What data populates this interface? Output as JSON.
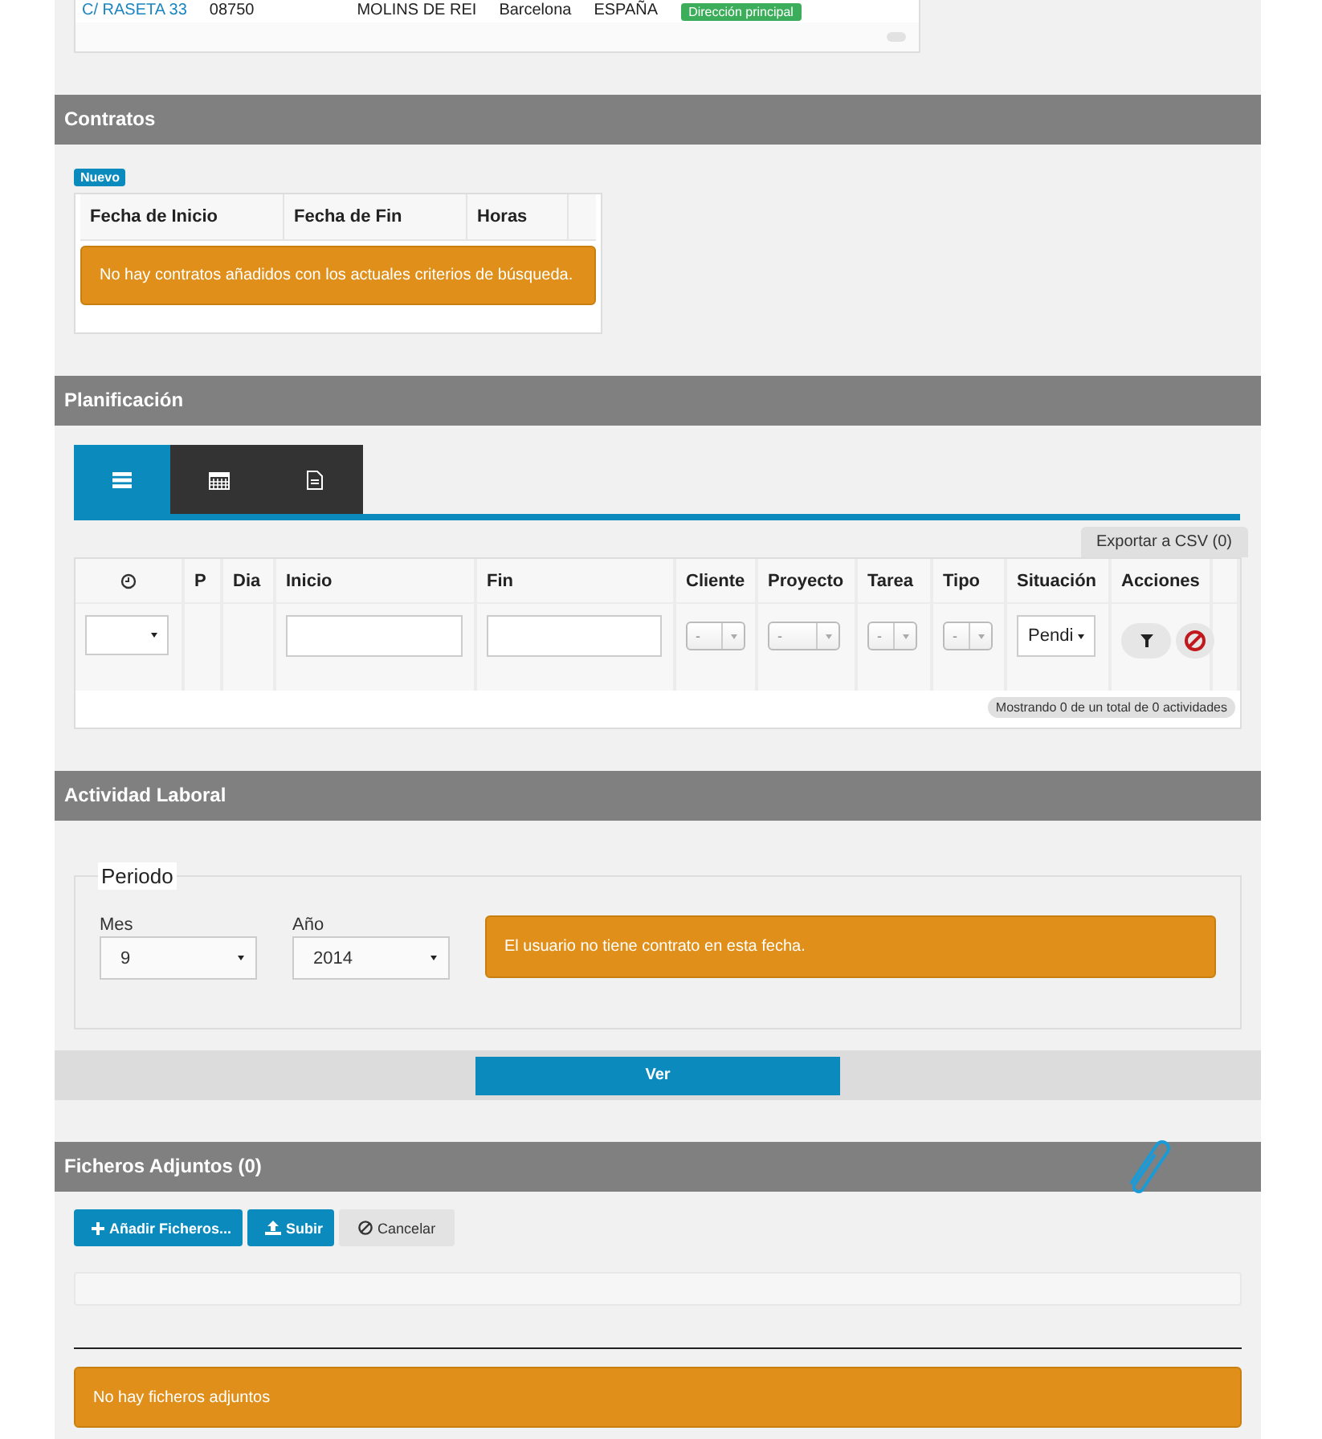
{
  "address": {
    "street": "C/ RASETA 33",
    "postal_code": "08750",
    "city": "MOLINS DE REI",
    "province": "Barcelona",
    "country": "ESPAÑA",
    "badge": "Dirección principal"
  },
  "contratos": {
    "title": "Contratos",
    "new_badge": "Nuevo",
    "columns": [
      "Fecha de Inicio",
      "Fecha de Fin",
      "Horas"
    ],
    "empty_message": "No hay contratos añadidos con los actuales criterios de búsqueda."
  },
  "planificacion": {
    "title": "Planificación",
    "tabs": [
      {
        "selected": true
      },
      {
        "selected": false
      },
      {
        "selected": false
      }
    ],
    "export_button": "Exportar a CSV (0)",
    "columns": [
      {
        "kind": "clock",
        "filter": {
          "kind": "select"
        }
      },
      {
        "kind": "text",
        "label": "P",
        "filter": {
          "kind": "none"
        }
      },
      {
        "kind": "text",
        "label": "Dia",
        "filter": {
          "kind": "none"
        }
      },
      {
        "kind": "text",
        "label": "Inicio",
        "filter": {
          "kind": "input"
        }
      },
      {
        "kind": "text",
        "label": "Fin",
        "filter": {
          "kind": "input"
        }
      },
      {
        "kind": "text",
        "label": "Cliente",
        "filter": {
          "kind": "combo",
          "value": "-"
        }
      },
      {
        "kind": "text",
        "label": "Proyecto",
        "filter": {
          "kind": "combo",
          "value": "-"
        }
      },
      {
        "kind": "text",
        "label": "Tarea",
        "filter": {
          "kind": "combo",
          "value": "-"
        }
      },
      {
        "kind": "text",
        "label": "Tipo",
        "filter": {
          "kind": "combo",
          "value": "-"
        }
      },
      {
        "kind": "text",
        "label": "Situación",
        "filter": {
          "kind": "select",
          "value": "Pendi"
        }
      },
      {
        "kind": "text",
        "label": "Acciones",
        "filter": {
          "kind": "actions"
        }
      }
    ],
    "status": "Mostrando 0 de un total de 0 actividades"
  },
  "actividad": {
    "title": "Actividad Laboral",
    "legend": "Periodo",
    "fields": [
      {
        "label": "Mes",
        "value": "9"
      },
      {
        "label": "Año",
        "value": "2014"
      }
    ],
    "alert": "El usuario no tiene contrato en esta fecha.",
    "button": "Ver"
  },
  "ficheros": {
    "title": "Ficheros Adjuntos (0)",
    "buttons": [
      {
        "kind": "primary",
        "label": "Añadir Ficheros..."
      },
      {
        "kind": "primary",
        "label": "Subir"
      },
      {
        "kind": "default",
        "label": "Cancelar"
      }
    ],
    "upload_progress": {
      "level": 0
    },
    "empty_message": "No hay ficheros adjuntos"
  }
}
